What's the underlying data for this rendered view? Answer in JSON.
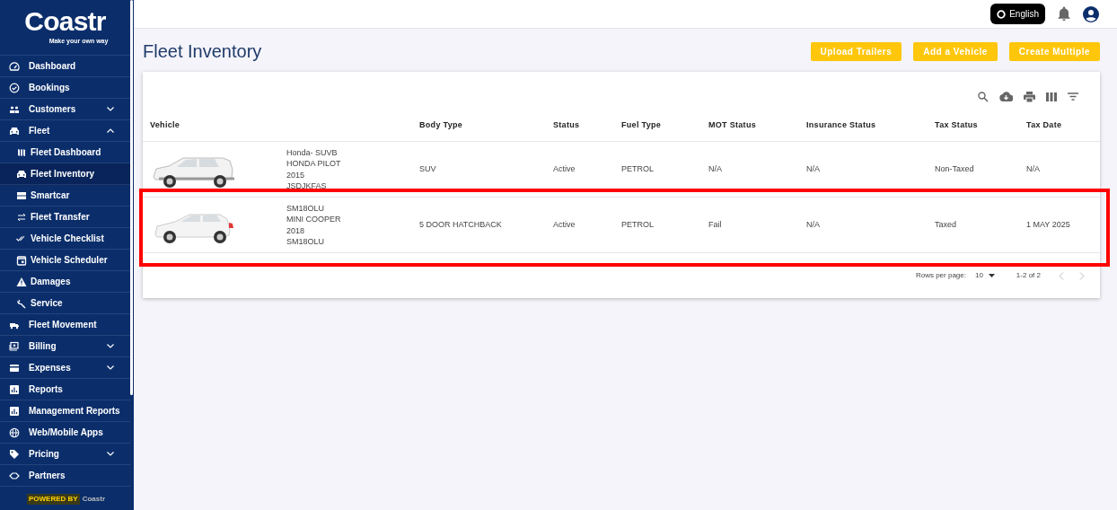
{
  "sidebar": {
    "logo": "Coastr",
    "tagline": "Make your own way",
    "items": [
      {
        "label": "Dashboard",
        "selected": false
      },
      {
        "label": "Bookings",
        "selected": false
      },
      {
        "label": "Customers",
        "selected": false,
        "expanded": false
      },
      {
        "label": "Fleet",
        "selected": false,
        "expanded": true,
        "children": [
          {
            "label": "Fleet Dashboard",
            "selected": false
          },
          {
            "label": "Fleet Inventory",
            "selected": true
          },
          {
            "label": "Smartcar",
            "selected": false
          },
          {
            "label": "Fleet Transfer",
            "selected": false
          },
          {
            "label": "Vehicle Checklist",
            "selected": false
          },
          {
            "label": "Vehicle Scheduler",
            "selected": false
          },
          {
            "label": "Damages",
            "selected": false
          },
          {
            "label": "Service",
            "selected": false
          }
        ]
      },
      {
        "label": "Fleet Movement",
        "selected": false
      },
      {
        "label": "Billing",
        "selected": false,
        "expanded": false
      },
      {
        "label": "Expenses",
        "selected": false,
        "expanded": false
      },
      {
        "label": "Reports",
        "selected": false
      },
      {
        "label": "Management Reports",
        "selected": false
      },
      {
        "label": "Web/Mobile Apps",
        "selected": false
      },
      {
        "label": "Pricing",
        "selected": false,
        "expanded": false
      },
      {
        "label": "Partners",
        "selected": false
      }
    ],
    "powered_by": {
      "text": "POWERED BY",
      "brand": "Coastr"
    }
  },
  "topbar": {
    "language": "English"
  },
  "page": {
    "title": "Fleet Inventory",
    "buttons": [
      "Upload Trailers",
      "Add a Vehicle",
      "Create Multiple"
    ]
  },
  "table": {
    "columns": [
      "Vehicle",
      "Body Type",
      "Status",
      "Fuel Type",
      "MOT Status",
      "Insurance Status",
      "Tax Status",
      "Tax Date"
    ],
    "rows": [
      {
        "kind": "suv",
        "highlighted": false,
        "cells": [
          "Honda- SUVB\nHONDA PILOT\n2015\nJSDJKFAS",
          "SUV",
          "Active",
          "PETROL",
          "N/A",
          "N/A",
          "Non-Taxed",
          "N/A"
        ]
      },
      {
        "kind": "hatchback",
        "highlighted": true,
        "cells": [
          "SM18OLU\nMINI COOPER\n2018\nSM18OLU",
          "5 DOOR HATCHBACK",
          "Active",
          "PETROL",
          "Fail",
          "N/A",
          "Taxed",
          "1 MAY 2025"
        ]
      }
    ],
    "footer": {
      "rows_label": "Rows per page:",
      "rows_value": "10",
      "range": "1-2 of 2"
    }
  }
}
